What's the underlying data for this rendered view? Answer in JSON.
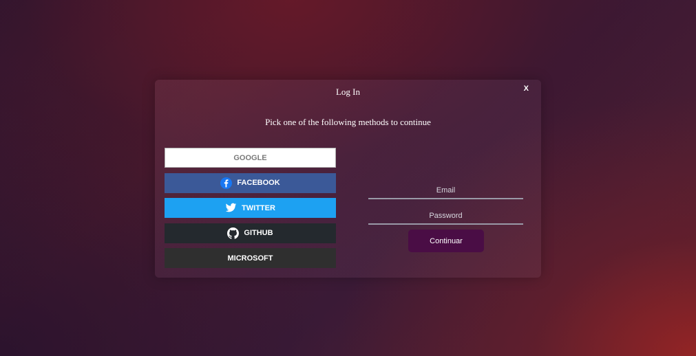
{
  "modal": {
    "title": "Log In",
    "close_label": "X",
    "subtitle": "Pick one of the following methods to continue"
  },
  "providers": [
    {
      "label": "GOOGLE",
      "icon": null
    },
    {
      "label": "FACEBOOK",
      "icon": "facebook-icon"
    },
    {
      "label": "TWITTER",
      "icon": "twitter-icon"
    },
    {
      "label": "GITHUB",
      "icon": "github-icon"
    },
    {
      "label": "MICROSOFT",
      "icon": null
    }
  ],
  "form": {
    "email_placeholder": "Email",
    "password_placeholder": "Password",
    "submit_label": "Continuar"
  },
  "colors": {
    "google": "#ffffff",
    "facebook": "#3b5998",
    "twitter": "#1da1f2",
    "github": "#24292e",
    "microsoft": "#2f2f2f",
    "submit": "#4a0d45"
  }
}
